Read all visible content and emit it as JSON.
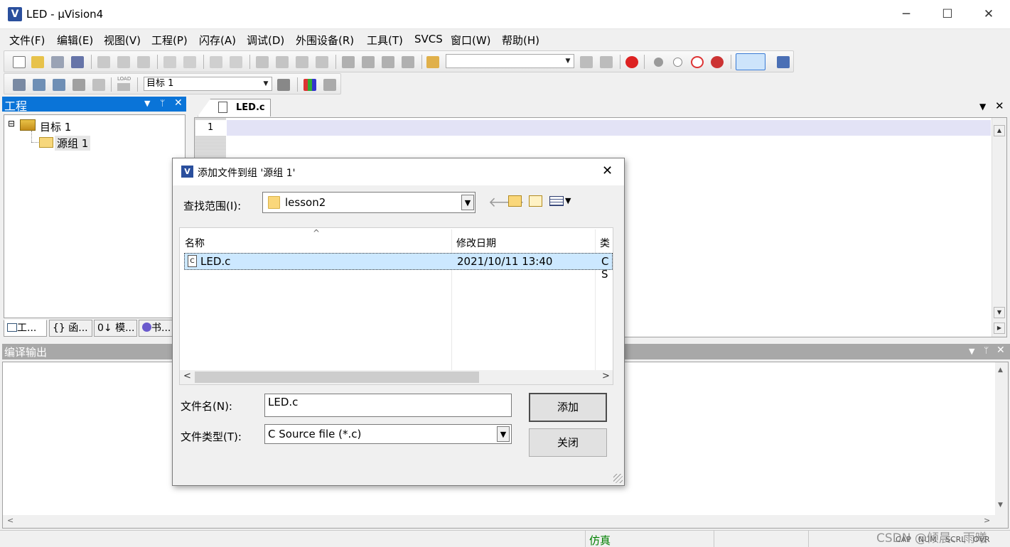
{
  "window": {
    "title": "LED  - µVision4",
    "icon": "uvision-icon",
    "min": "─",
    "max": "☐",
    "close": "✕"
  },
  "menu": [
    "文件(F)",
    "编辑(E)",
    "视图(V)",
    "工程(P)",
    "闪存(A)",
    "调试(D)",
    "外围设备(R)",
    "工具(T)",
    "SVCS",
    "窗口(W)",
    "帮助(H)"
  ],
  "toolbar": {
    "target_value": "目标 1",
    "load_label": "LOAD",
    "search_value": ""
  },
  "project_panel": {
    "title": "工程",
    "tree": {
      "root_toggle": "⊟",
      "root": "目标 1",
      "group": "源组 1"
    },
    "tabs": [
      "工...",
      "{} 函...",
      "0↓ 模...",
      "书..."
    ]
  },
  "editor": {
    "tab_label": "LED.c",
    "line_numbers": [
      "1"
    ]
  },
  "output_panel": {
    "title": "编译输出"
  },
  "statusbar": {
    "mode": "仿真",
    "indicators": [
      "CAP",
      "NUM",
      "SCRL",
      "OVR"
    ],
    "watermark": "CSDN @倾晨、雨曦"
  },
  "dialog": {
    "title": "添加文件到组 '源组 1'",
    "lookin_label": "查找范围(I):",
    "lookin_value": "lesson2",
    "columns": {
      "name": "名称",
      "date": "修改日期",
      "type": "类"
    },
    "files": [
      {
        "name": "LED.c",
        "date": "2021/10/11 13:40",
        "type": "C S"
      }
    ],
    "filename_label": "文件名(N):",
    "filename_value": "LED.c",
    "filetype_label": "文件类型(T):",
    "filetype_value": "C Source file (*.c)",
    "add_button": "添加",
    "close_button": "关闭",
    "sort_arrow": "^"
  },
  "colors": {
    "accent": "#0a74d8",
    "selection": "#cce8ff",
    "current_line": "#e3e3f6",
    "status_green": "#008000"
  }
}
